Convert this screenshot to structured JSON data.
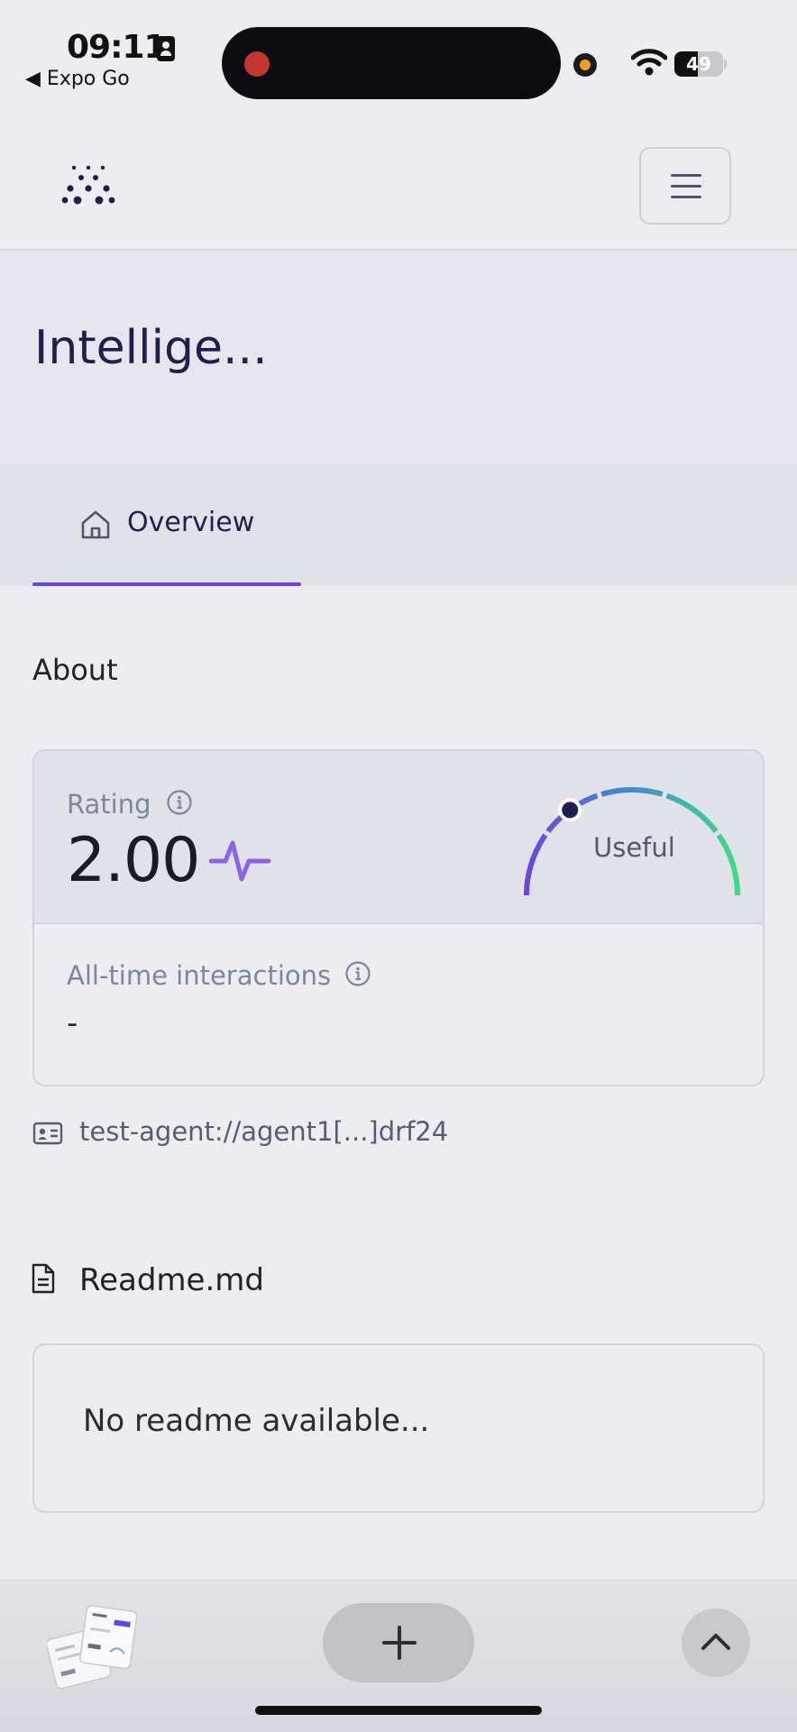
{
  "status_bar": {
    "time": "09:11",
    "back_app": "◀ Expo Go",
    "battery_level": "49",
    "battery_fraction": 0.49
  },
  "header": {
    "logo_icon": "dots-grid-logo",
    "menu_icon": "hamburger-icon"
  },
  "page": {
    "title": "Intellige..."
  },
  "tabs": [
    {
      "label": "Overview",
      "icon": "home-icon",
      "active": true
    }
  ],
  "about": {
    "heading": "About",
    "rating_label": "Rating",
    "rating_value": "2.00",
    "gauge_label": "Useful",
    "interactions_label": "All-time interactions",
    "interactions_value": "-",
    "agent_id": "test-agent://agent1[...]drf24"
  },
  "readme": {
    "title": "Readme.md",
    "empty_text": "No readme available..."
  },
  "bottom_bar": {
    "plus_icon": "plus-icon",
    "up_icon": "chevron-up-icon"
  },
  "colors": {
    "accent": "#6a46e0",
    "title": "#1d1f4f",
    "gauge_start": "#6a46e0",
    "gauge_end": "#3ddc84"
  }
}
